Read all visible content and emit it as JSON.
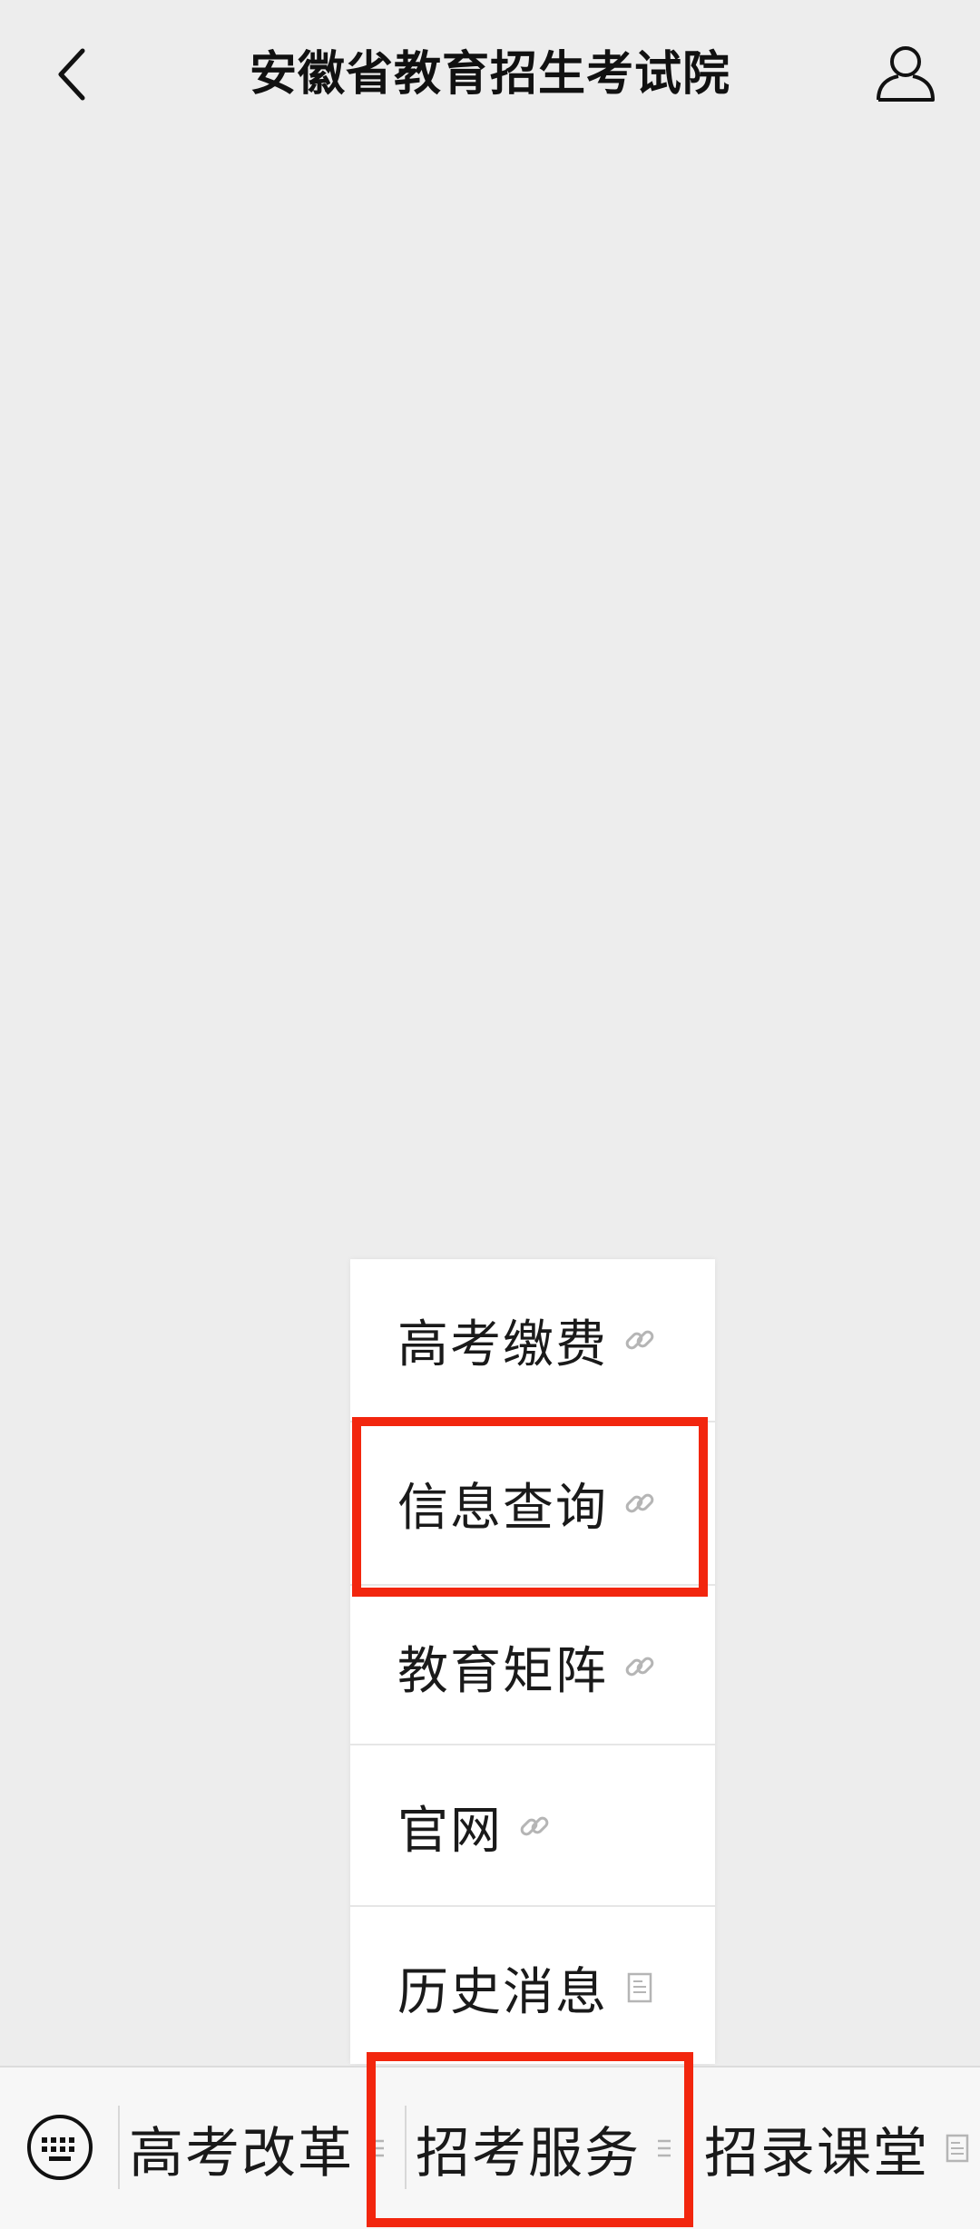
{
  "header": {
    "title": "安徽省教育招生考试院",
    "back_icon": "chevron-left-icon",
    "profile_icon": "user-icon"
  },
  "popup_menu": {
    "items": [
      {
        "label": "高考缴费",
        "icon": "link-icon"
      },
      {
        "label": "信息查询",
        "icon": "link-icon"
      },
      {
        "label": "教育矩阵",
        "icon": "link-icon"
      },
      {
        "label": "官网",
        "icon": "link-icon"
      },
      {
        "label": "历史消息",
        "icon": "document-icon"
      }
    ]
  },
  "bottom_bar": {
    "keyboard_icon": "keyboard-icon",
    "tabs": [
      {
        "label": "高考改革",
        "icon": "submenu-icon"
      },
      {
        "label": "招考服务",
        "icon": "submenu-icon"
      },
      {
        "label": "招录课堂",
        "icon": "document-icon"
      }
    ]
  },
  "colors": {
    "highlight": "#f2260e",
    "background": "#ededed",
    "menu_bg": "#ffffff",
    "icon_gray": "#b5b5b5"
  }
}
